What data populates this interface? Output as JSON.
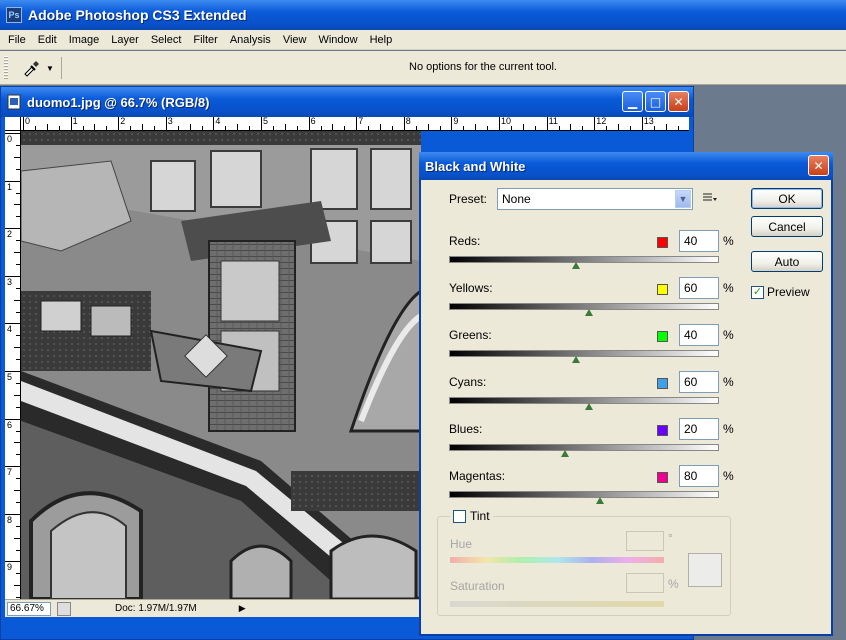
{
  "app": {
    "title": "Adobe Photoshop CS3 Extended",
    "icon": "Ps"
  },
  "menu": [
    "File",
    "Edit",
    "Image",
    "Layer",
    "Select",
    "Filter",
    "Analysis",
    "View",
    "Window",
    "Help"
  ],
  "options_bar": {
    "message": "No options for the current tool.",
    "tool_icon": "eyedropper-icon"
  },
  "document": {
    "title": "duomo1.jpg @ 66.7% (RGB/8)",
    "ruler_h": [
      "0",
      "1",
      "2",
      "3",
      "4",
      "5",
      "6",
      "7",
      "8",
      "9",
      "10",
      "11",
      "12",
      "13"
    ],
    "ruler_v": [
      "0",
      "1",
      "2",
      "3",
      "4",
      "5",
      "6",
      "7",
      "8",
      "9"
    ],
    "zoom": "66.67%",
    "doc_size": "Doc: 1.97M/1.97M"
  },
  "dialog": {
    "title": "Black and White",
    "preset_label": "Preset:",
    "preset_value": "None",
    "buttons": {
      "ok": "OK",
      "cancel": "Cancel",
      "auto": "Auto"
    },
    "preview_label": "Preview",
    "preview_checked": true,
    "channels": [
      {
        "label": "Reds:",
        "value": "40",
        "unit": "%",
        "color": "#ff0000",
        "level": 0.47
      },
      {
        "label": "Yellows:",
        "value": "60",
        "unit": "%",
        "color": "#ffff00",
        "level": 0.52
      },
      {
        "label": "Greens:",
        "value": "40",
        "unit": "%",
        "color": "#00ff00",
        "level": 0.47
      },
      {
        "label": "Cyans:",
        "value": "60",
        "unit": "%",
        "color": "#3fa0e8",
        "level": 0.52
      },
      {
        "label": "Blues:",
        "value": "20",
        "unit": "%",
        "color": "#6a00ff",
        "level": 0.43
      },
      {
        "label": "Magentas:",
        "value": "80",
        "unit": "%",
        "color": "#f00090",
        "level": 0.56
      }
    ],
    "tint": {
      "label": "Tint",
      "checked": false,
      "hue_label": "Hue",
      "hue_unit": "°",
      "saturation_label": "Saturation",
      "saturation_unit": "%"
    }
  }
}
